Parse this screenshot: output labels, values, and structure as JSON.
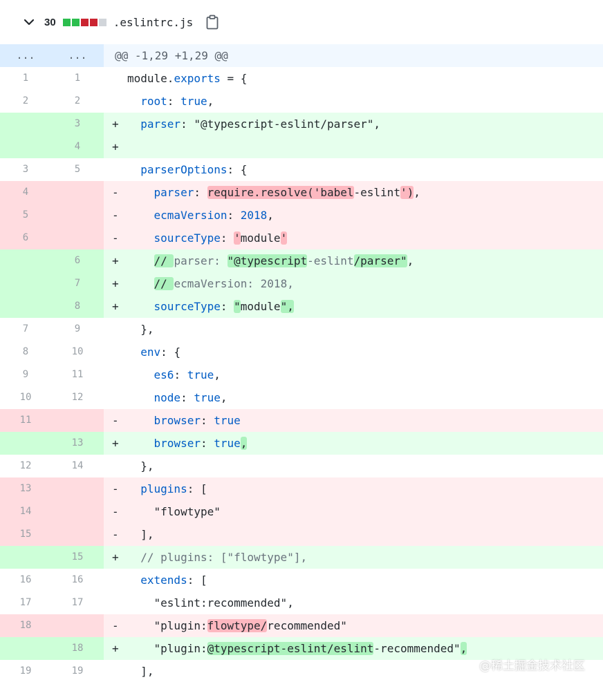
{
  "file": {
    "changes_count": "30",
    "name": ".eslintrc.js",
    "stat_colors": [
      "#2cbe4e",
      "#2cbe4e",
      "#cb2431",
      "#cb2431",
      "#d1d5da"
    ]
  },
  "hunk": {
    "old": "...",
    "new": "...",
    "header": "@@ -1,29 +1,29 @@"
  },
  "lines": [
    {
      "type": "ctx",
      "old": "1",
      "new": "1",
      "sign": " ",
      "segs": [
        [
          "t",
          "module."
        ],
        [
          "k",
          "exports"
        ],
        [
          "t",
          " = {"
        ]
      ]
    },
    {
      "type": "ctx",
      "old": "2",
      "new": "2",
      "sign": " ",
      "segs": [
        [
          "t",
          "  "
        ],
        [
          "k",
          "root"
        ],
        [
          "t",
          ": "
        ],
        [
          "k",
          "true"
        ],
        [
          "t",
          ","
        ]
      ]
    },
    {
      "type": "add",
      "old": "",
      "new": "3",
      "sign": "+",
      "segs": [
        [
          "t",
          "  "
        ],
        [
          "k",
          "parser"
        ],
        [
          "t",
          ": \"@typescript-eslint/parser\","
        ]
      ]
    },
    {
      "type": "add",
      "old": "",
      "new": "4",
      "sign": "+",
      "segs": []
    },
    {
      "type": "ctx",
      "old": "3",
      "new": "5",
      "sign": " ",
      "segs": [
        [
          "t",
          "  "
        ],
        [
          "k",
          "parserOptions"
        ],
        [
          "t",
          ": {"
        ]
      ]
    },
    {
      "type": "del",
      "old": "4",
      "new": "",
      "sign": "-",
      "segs": [
        [
          "t",
          "    "
        ],
        [
          "k",
          "parser"
        ],
        [
          "t",
          ": "
        ],
        [
          "hd",
          "require.resolve('babel"
        ],
        [
          "t",
          "-eslint"
        ],
        [
          "hd",
          "')"
        ],
        [
          "t",
          ","
        ]
      ]
    },
    {
      "type": "del",
      "old": "5",
      "new": "",
      "sign": "-",
      "segs": [
        [
          "t",
          "    "
        ],
        [
          "k",
          "ecmaVersion"
        ],
        [
          "t",
          ": "
        ],
        [
          "k",
          "2018"
        ],
        [
          "t",
          ","
        ]
      ]
    },
    {
      "type": "del",
      "old": "6",
      "new": "",
      "sign": "-",
      "segs": [
        [
          "t",
          "    "
        ],
        [
          "k",
          "sourceType"
        ],
        [
          "t",
          ": "
        ],
        [
          "hd",
          "'"
        ],
        [
          "t",
          "module"
        ],
        [
          "hd",
          "'"
        ]
      ]
    },
    {
      "type": "add",
      "old": "",
      "new": "6",
      "sign": "+",
      "segs": [
        [
          "t",
          "    "
        ],
        [
          "ha",
          "// "
        ],
        [
          "c",
          "parser: "
        ],
        [
          "ha",
          "\"@typescript"
        ],
        [
          "c",
          "-eslint"
        ],
        [
          "ha",
          "/parser\""
        ],
        [
          "t",
          ","
        ]
      ]
    },
    {
      "type": "add",
      "old": "",
      "new": "7",
      "sign": "+",
      "segs": [
        [
          "t",
          "    "
        ],
        [
          "ha",
          "// "
        ],
        [
          "c",
          "ecmaVersion: 2018,"
        ]
      ]
    },
    {
      "type": "add",
      "old": "",
      "new": "8",
      "sign": "+",
      "segs": [
        [
          "t",
          "    "
        ],
        [
          "k",
          "sourceType"
        ],
        [
          "t",
          ": "
        ],
        [
          "ha",
          "\""
        ],
        [
          "t",
          "module"
        ],
        [
          "ha",
          "\","
        ]
      ]
    },
    {
      "type": "ctx",
      "old": "7",
      "new": "9",
      "sign": " ",
      "segs": [
        [
          "t",
          "  },"
        ]
      ]
    },
    {
      "type": "ctx",
      "old": "8",
      "new": "10",
      "sign": " ",
      "segs": [
        [
          "t",
          "  "
        ],
        [
          "k",
          "env"
        ],
        [
          "t",
          ": {"
        ]
      ]
    },
    {
      "type": "ctx",
      "old": "9",
      "new": "11",
      "sign": " ",
      "segs": [
        [
          "t",
          "    "
        ],
        [
          "k",
          "es6"
        ],
        [
          "t",
          ": "
        ],
        [
          "k",
          "true"
        ],
        [
          "t",
          ","
        ]
      ]
    },
    {
      "type": "ctx",
      "old": "10",
      "new": "12",
      "sign": " ",
      "segs": [
        [
          "t",
          "    "
        ],
        [
          "k",
          "node"
        ],
        [
          "t",
          ": "
        ],
        [
          "k",
          "true"
        ],
        [
          "t",
          ","
        ]
      ]
    },
    {
      "type": "del",
      "old": "11",
      "new": "",
      "sign": "-",
      "segs": [
        [
          "t",
          "    "
        ],
        [
          "k",
          "browser"
        ],
        [
          "t",
          ": "
        ],
        [
          "k",
          "true"
        ]
      ]
    },
    {
      "type": "add",
      "old": "",
      "new": "13",
      "sign": "+",
      "segs": [
        [
          "t",
          "    "
        ],
        [
          "k",
          "browser"
        ],
        [
          "t",
          ": "
        ],
        [
          "k",
          "true"
        ],
        [
          "ha",
          ","
        ]
      ]
    },
    {
      "type": "ctx",
      "old": "12",
      "new": "14",
      "sign": " ",
      "segs": [
        [
          "t",
          "  },"
        ]
      ]
    },
    {
      "type": "del",
      "old": "13",
      "new": "",
      "sign": "-",
      "segs": [
        [
          "t",
          "  "
        ],
        [
          "k",
          "plugins"
        ],
        [
          "t",
          ": ["
        ]
      ]
    },
    {
      "type": "del",
      "old": "14",
      "new": "",
      "sign": "-",
      "segs": [
        [
          "t",
          "    \"flowtype\""
        ]
      ]
    },
    {
      "type": "del",
      "old": "15",
      "new": "",
      "sign": "-",
      "segs": [
        [
          "t",
          "  ],"
        ]
      ]
    },
    {
      "type": "add",
      "old": "",
      "new": "15",
      "sign": "+",
      "segs": [
        [
          "t",
          "  "
        ],
        [
          "c",
          "// plugins: [\"flowtype\"],"
        ]
      ]
    },
    {
      "type": "ctx",
      "old": "16",
      "new": "16",
      "sign": " ",
      "segs": [
        [
          "t",
          "  "
        ],
        [
          "k",
          "extends"
        ],
        [
          "t",
          ": ["
        ]
      ]
    },
    {
      "type": "ctx",
      "old": "17",
      "new": "17",
      "sign": " ",
      "segs": [
        [
          "t",
          "    \"eslint:recommended\","
        ]
      ]
    },
    {
      "type": "del",
      "old": "18",
      "new": "",
      "sign": "-",
      "segs": [
        [
          "t",
          "    \"plugin:"
        ],
        [
          "hd",
          "flowtype/"
        ],
        [
          "t",
          "recommended\""
        ]
      ]
    },
    {
      "type": "add",
      "old": "",
      "new": "18",
      "sign": "+",
      "segs": [
        [
          "t",
          "    \"plugin:"
        ],
        [
          "ha",
          "@typescript-eslint/eslint"
        ],
        [
          "t",
          "-recommended\""
        ],
        [
          "ha",
          ","
        ]
      ]
    },
    {
      "type": "ctx",
      "old": "19",
      "new": "19",
      "sign": " ",
      "segs": [
        [
          "t",
          "  ],"
        ]
      ]
    }
  ],
  "watermark": "@稀土掘金技术社区"
}
